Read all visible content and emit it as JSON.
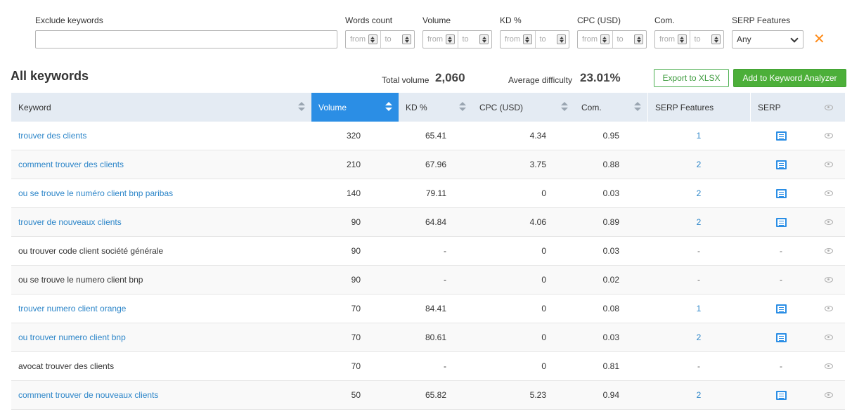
{
  "filters": {
    "exclude_label": "Exclude keywords",
    "exclude_value": "",
    "words_count_label": "Words count",
    "volume_label": "Volume",
    "kd_label": "KD %",
    "cpc_label": "CPC (USD)",
    "com_label": "Com.",
    "serp_label": "SERP Features",
    "from_placeholder": "from",
    "to_placeholder": "to",
    "serp_selected": "Any",
    "clear_glyph": "✕"
  },
  "summary": {
    "title": "All keywords",
    "total_volume_label": "Total volume",
    "total_volume_value": "2,060",
    "avg_difficulty_label": "Average difficulty",
    "avg_difficulty_value": "23.01%",
    "export_label": "Export to XLSX",
    "add_label": "Add to Keyword Analyzer"
  },
  "table": {
    "headers": {
      "keyword": "Keyword",
      "volume": "Volume",
      "kd": "KD %",
      "cpc": "CPC (USD)",
      "com": "Com.",
      "serp_features": "SERP Features",
      "serp": "SERP"
    },
    "rows": [
      {
        "keyword": "trouver des clients",
        "link": true,
        "volume": "320",
        "kd": "65.41",
        "cpc": "4.34",
        "com": "0.95",
        "serp_features": "1",
        "serp": "icon"
      },
      {
        "keyword": "comment trouver des clients",
        "link": true,
        "volume": "210",
        "kd": "67.96",
        "cpc": "3.75",
        "com": "0.88",
        "serp_features": "2",
        "serp": "icon"
      },
      {
        "keyword": "ou se trouve le numéro client bnp paribas",
        "link": true,
        "volume": "140",
        "kd": "79.11",
        "cpc": "0",
        "com": "0.03",
        "serp_features": "2",
        "serp": "icon"
      },
      {
        "keyword": "trouver de nouveaux clients",
        "link": true,
        "volume": "90",
        "kd": "64.84",
        "cpc": "4.06",
        "com": "0.89",
        "serp_features": "2",
        "serp": "icon"
      },
      {
        "keyword": "ou trouver code client société générale",
        "link": false,
        "volume": "90",
        "kd": "-",
        "cpc": "0",
        "com": "0.03",
        "serp_features": "-",
        "serp": "-"
      },
      {
        "keyword": "ou se trouve le numero client bnp",
        "link": false,
        "volume": "90",
        "kd": "-",
        "cpc": "0",
        "com": "0.02",
        "serp_features": "-",
        "serp": "-"
      },
      {
        "keyword": "trouver numero client orange",
        "link": true,
        "volume": "70",
        "kd": "84.41",
        "cpc": "0",
        "com": "0.08",
        "serp_features": "1",
        "serp": "icon"
      },
      {
        "keyword": "ou trouver numero client bnp",
        "link": true,
        "volume": "70",
        "kd": "80.61",
        "cpc": "0",
        "com": "0.03",
        "serp_features": "2",
        "serp": "icon"
      },
      {
        "keyword": "avocat trouver des clients",
        "link": false,
        "volume": "70",
        "kd": "-",
        "cpc": "0",
        "com": "0.81",
        "serp_features": "-",
        "serp": "-"
      },
      {
        "keyword": "comment trouver de nouveaux clients",
        "link": true,
        "volume": "50",
        "kd": "65.82",
        "cpc": "5.23",
        "com": "0.94",
        "serp_features": "2",
        "serp": "icon"
      }
    ]
  },
  "colors": {
    "accent": "#2b8ee5",
    "link": "#2d86c9",
    "primary_button": "#4caf39",
    "clear": "#ff8c1a"
  }
}
